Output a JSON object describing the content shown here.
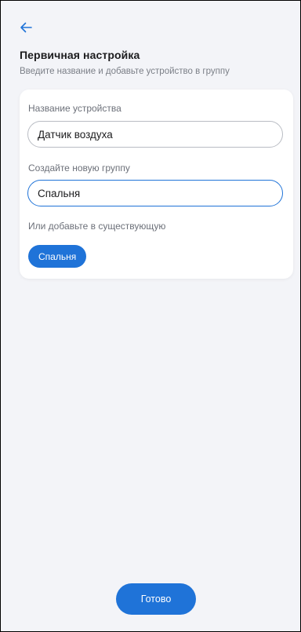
{
  "header": {
    "back_icon": "arrow-left-icon",
    "title": "Первичная настройка",
    "subtitle": "Введите название и добавьте устройство в группу"
  },
  "form": {
    "device_name_label": "Название устройства",
    "device_name_value": "Датчик воздуха",
    "new_group_label": "Создайте новую группу",
    "new_group_value": "Спальня",
    "existing_group_label": "Или добавьте в существующую",
    "existing_groups": [
      "Спальня"
    ]
  },
  "footer": {
    "done_label": "Готово"
  },
  "colors": {
    "accent": "#1f73d8",
    "background": "#f3f4f8",
    "card": "#ffffff"
  }
}
